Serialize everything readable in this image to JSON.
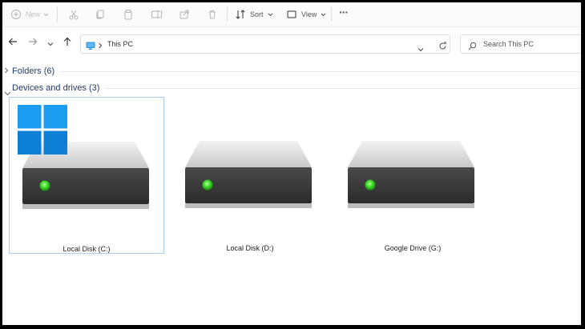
{
  "toolbar": {
    "new_label": "New",
    "sort_label": "Sort",
    "view_label": "View",
    "more_label": "···"
  },
  "address": {
    "location": "This PC",
    "search_placeholder": "Search This PC"
  },
  "groups": {
    "folders": "Folders (6)",
    "devices": "Devices and drives (3)"
  },
  "drives": [
    {
      "label": "Local Disk (C:)",
      "selected": true,
      "has_windows_logo": true
    },
    {
      "label": "Local Disk (D:)",
      "selected": false,
      "has_windows_logo": false
    },
    {
      "label": "Google Drive (G:)",
      "selected": false,
      "has_windows_logo": false
    }
  ],
  "colors": {
    "accent_text": "#1f3a6e",
    "windows_blue": "#1a9cf0",
    "led_green": "#3ddc2a",
    "selection_border": "#a9cdee"
  }
}
